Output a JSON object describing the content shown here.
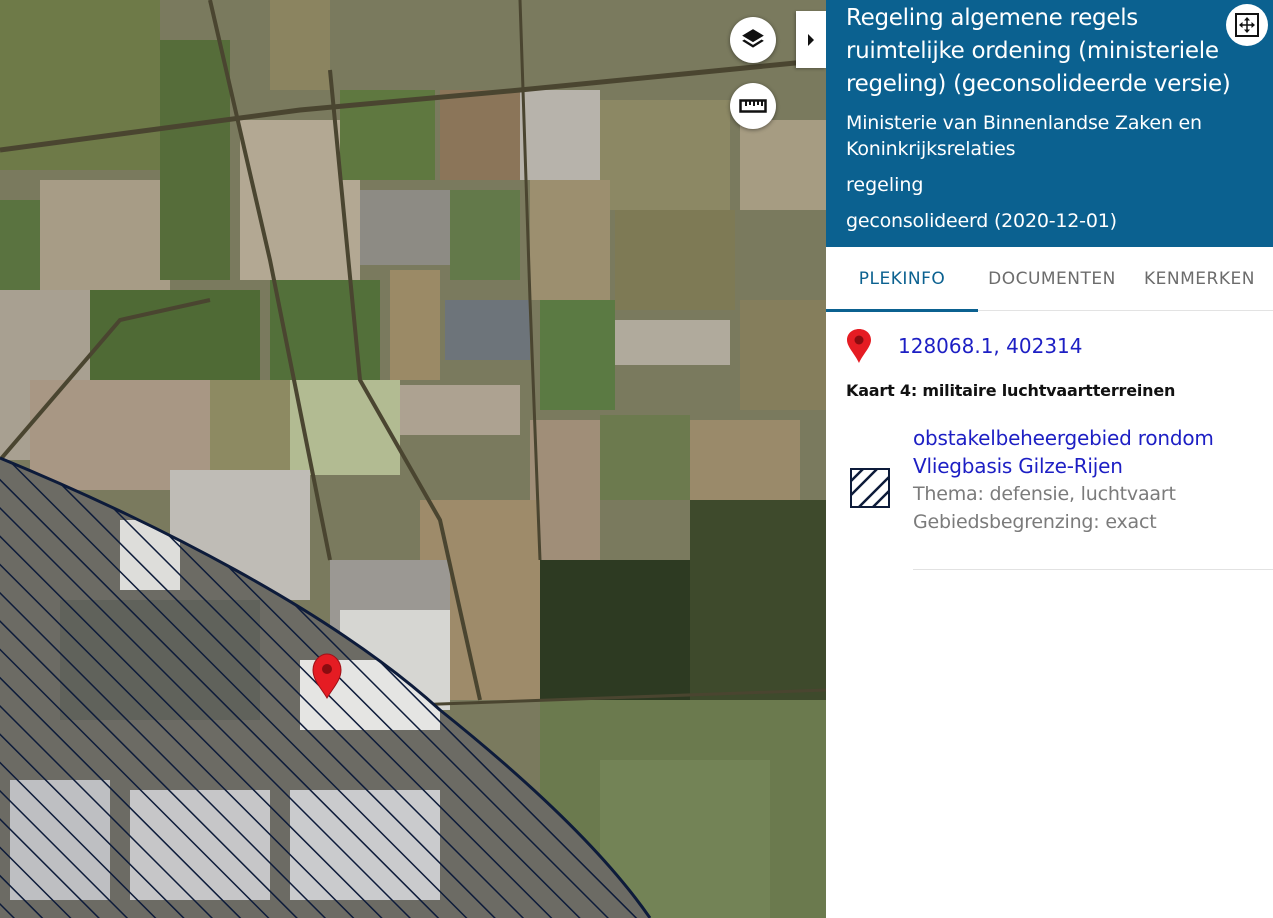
{
  "map": {
    "layers_button": "layers-icon",
    "measure_button": "ruler-icon",
    "collapse_toggle": "chevron-right-icon",
    "hatch_color": "#0d1b3a",
    "marker_color": "#e51c23"
  },
  "panel": {
    "header_color": "#0b6190",
    "title": "Regeling algemene regels ruimtelijke ordening (ministeriele regeling) (geconsolideerde versie)",
    "organisation": "Ministerie van Binnenlandse Zaken en Koninkrijksrelaties",
    "doc_type": "regeling",
    "status": "geconsolideerd (2020-12-01)",
    "fullscreen_icon": "fullscreen-icon",
    "tabs": [
      {
        "label": "PLEKINFO",
        "active": true
      },
      {
        "label": "DOCUMENTEN",
        "active": false
      },
      {
        "label": "KENMERKEN",
        "active": false
      }
    ],
    "location": {
      "coordinates": "128068.1, 402314",
      "icon": "map-pin-icon"
    },
    "map_heading": "Kaart 4: militaire luchtvaartterreinen",
    "feature": {
      "name": "obstakelbeheergebied rondom Vliegbasis Gilze-Rijen",
      "thema": "Thema: defensie, luchtvaart",
      "begrenzing": "Gebiedsbegrenzing: exact",
      "icon": "hatch-legend-icon"
    }
  }
}
